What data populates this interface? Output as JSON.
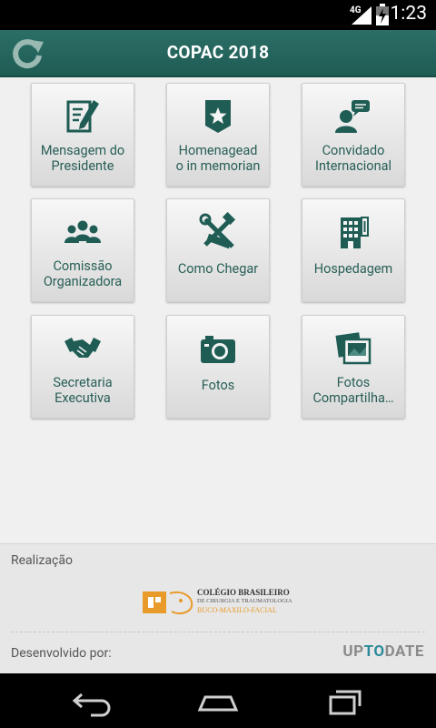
{
  "status_bar": {
    "network": "4G",
    "time": "1:23"
  },
  "app": {
    "title": "COPAC 2018"
  },
  "tiles": [
    {
      "label_1": "Mensagem do",
      "label_2": "Presidente",
      "icon": "document-pen-icon"
    },
    {
      "label_1": "Homenagead",
      "label_2": "o in memorian",
      "icon": "star-badge-icon"
    },
    {
      "label_1": "Convidado",
      "label_2": "Internacional",
      "icon": "speaker-chat-icon"
    },
    {
      "label_1": "Comissão",
      "label_2": "Organizadora",
      "icon": "group-icon"
    },
    {
      "label": "Como Chegar",
      "icon": "tools-icon"
    },
    {
      "label": "Hospedagem",
      "icon": "hotel-building-icon"
    },
    {
      "label_1": "Secretaria",
      "label_2": "Executiva",
      "icon": "handshake-icon"
    },
    {
      "label": "Fotos",
      "icon": "camera-icon"
    },
    {
      "label_1": "Fotos",
      "label_2": "Compartilha…",
      "icon": "photos-stack-icon"
    }
  ],
  "footer": {
    "realizacao": "Realização",
    "logo_line1": "COLÉGIO BRASILEIRO",
    "logo_line2": "DE CIRURGIA E TRAUMATOLOGIA",
    "logo_line3": "BUCO-MAXILO-FACIAL",
    "developed_by": "Desenvolvido por:",
    "dev_brand_a": "UP",
    "dev_brand_b": "TO",
    "dev_brand_c": "DATE"
  },
  "colors": {
    "primary": "#1f5c54",
    "tile_text": "#285f57",
    "accent": "#e89a2a"
  }
}
